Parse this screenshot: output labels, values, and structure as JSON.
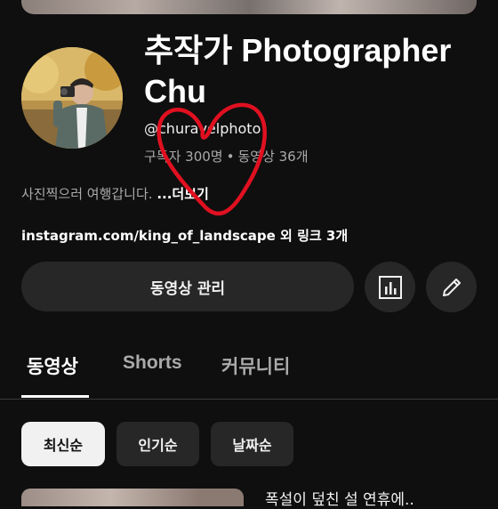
{
  "channel": {
    "name": "추작가 Photographer Chu",
    "handle": "@churavelphoto",
    "subscribers": "구독자 300명",
    "separator": "•",
    "videos_count": "동영상 36개",
    "description": "사진찍으러 여행갑니다.",
    "more_label": "...더보기",
    "link_text": "instagram.com/king_of_landscape 외 링크 3개"
  },
  "actions": {
    "manage_label": "동영상 관리",
    "analytics_icon": "analytics-icon",
    "edit_icon": "pencil-icon"
  },
  "tabs": [
    {
      "label": "동영상",
      "active": true
    },
    {
      "label": "Shorts",
      "active": false
    },
    {
      "label": "커뮤니티",
      "active": false
    }
  ],
  "chips": [
    {
      "label": "최신순",
      "selected": true
    },
    {
      "label": "인기순",
      "selected": false
    },
    {
      "label": "날짜순",
      "selected": false
    }
  ],
  "video": {
    "title_partial": "폭설이 덮친 설 연휴에.."
  },
  "colors": {
    "background": "#0f0f0f",
    "button": "#272727",
    "annotation": "#e01020"
  }
}
